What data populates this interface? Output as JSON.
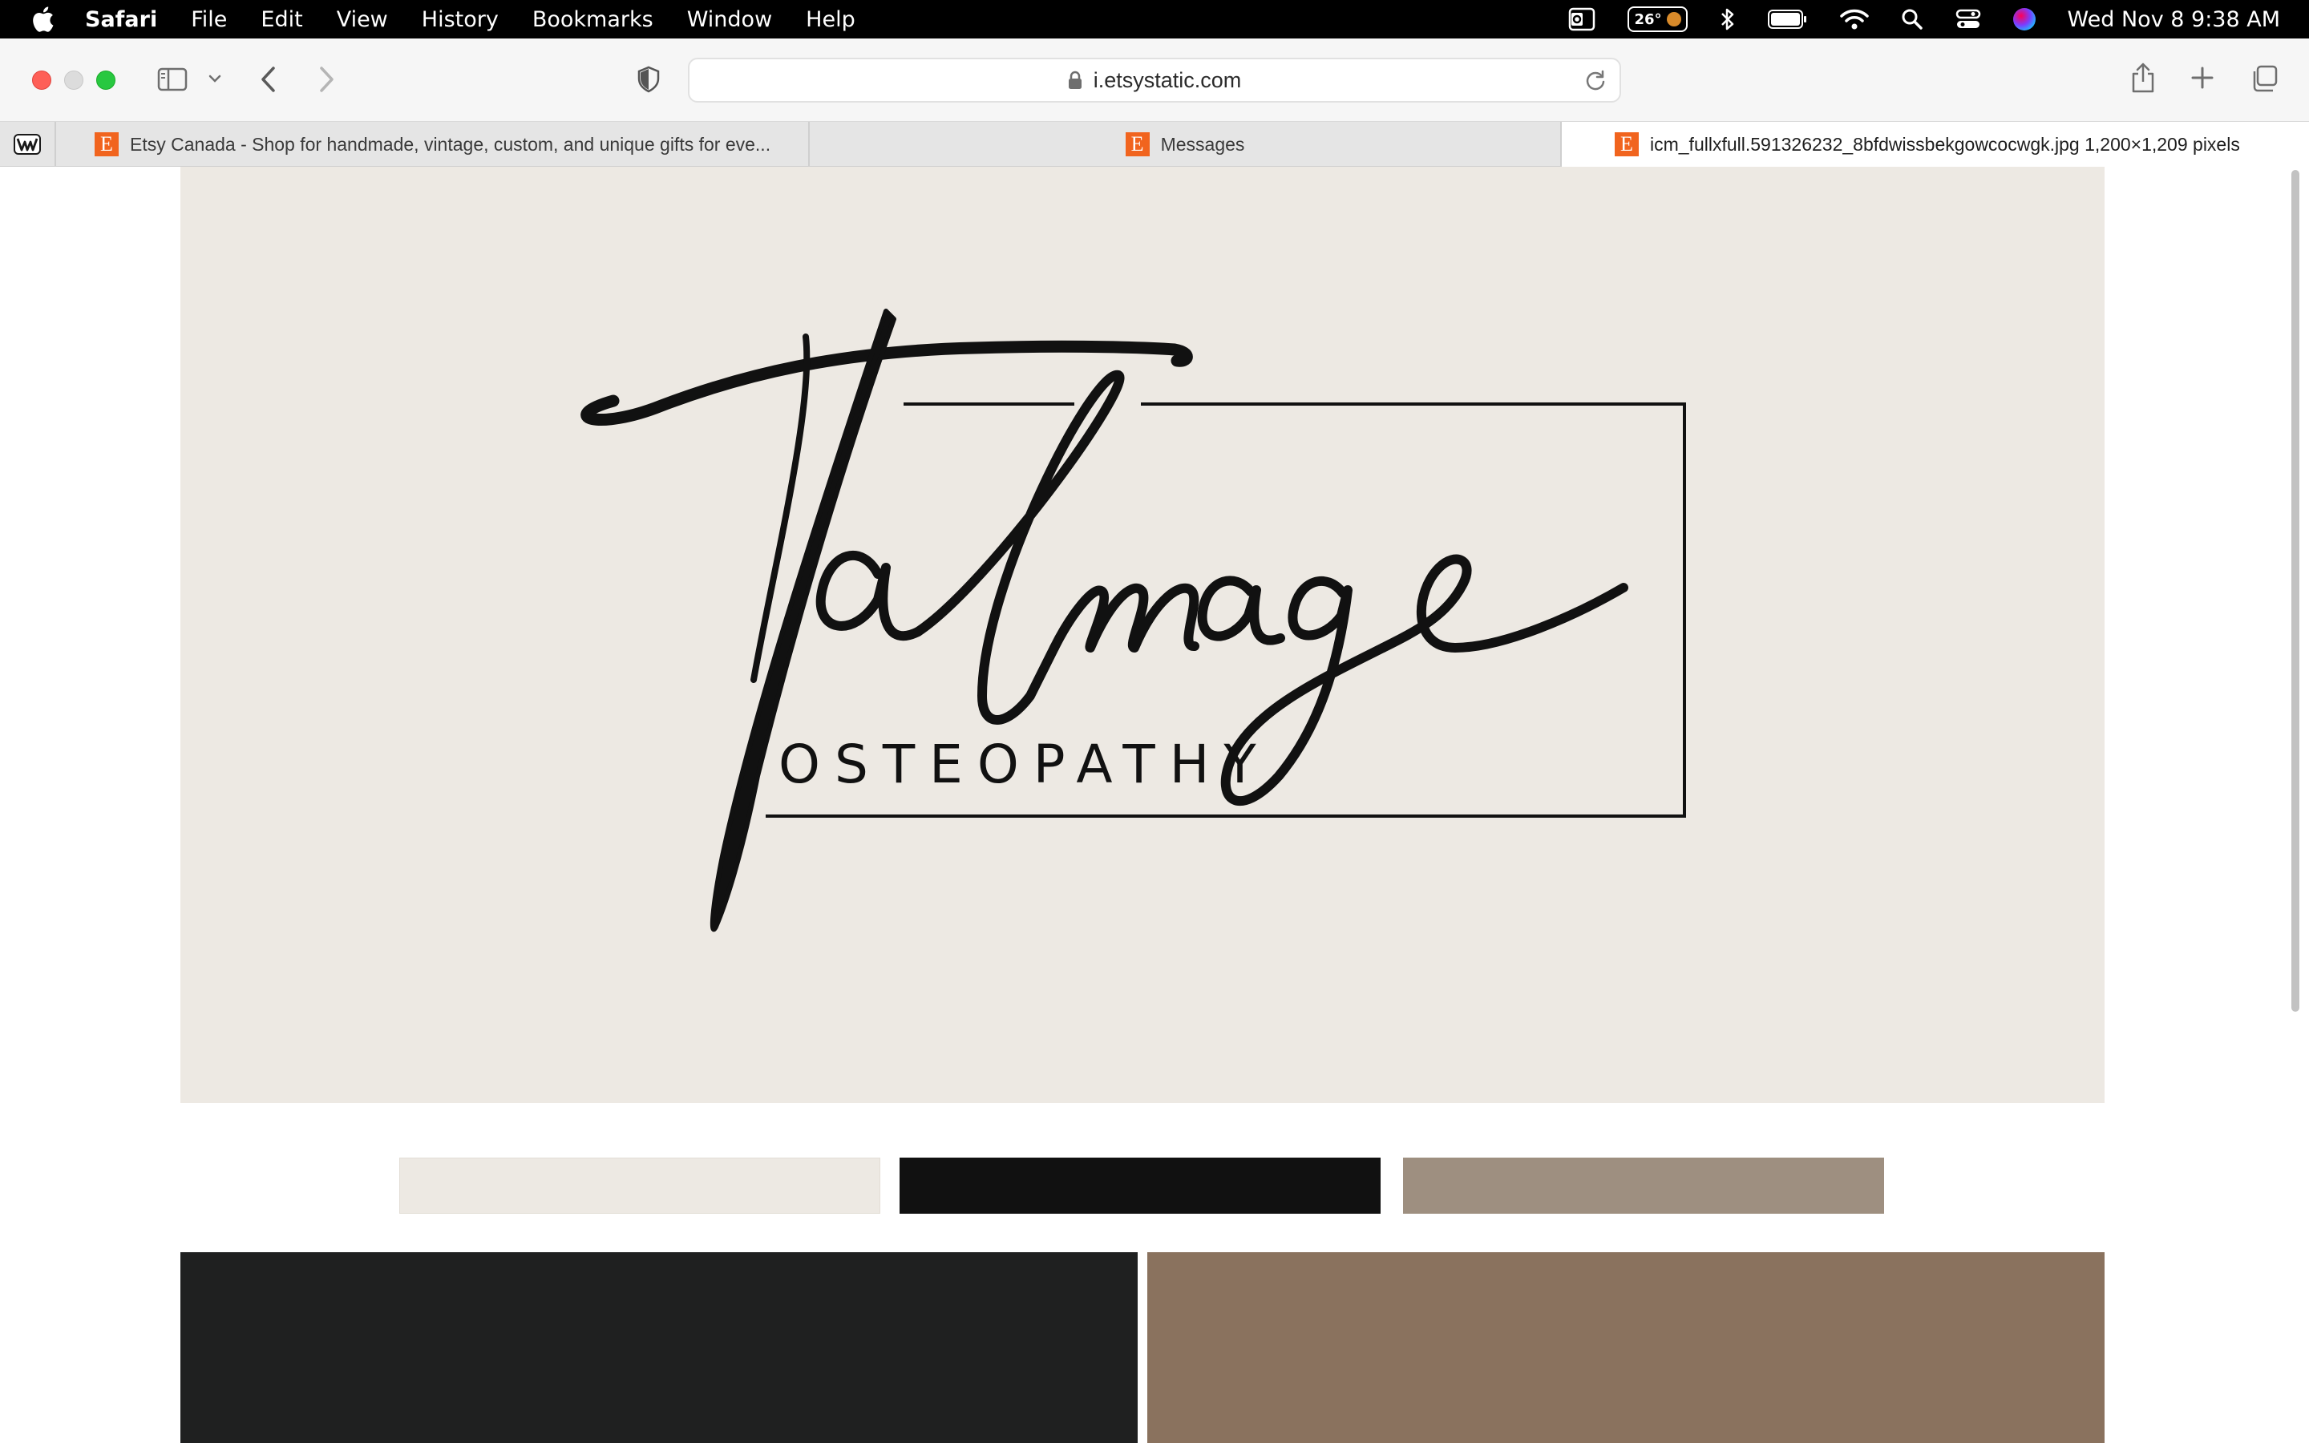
{
  "menubar": {
    "app_name": "Safari",
    "menus": [
      "File",
      "Edit",
      "View",
      "History",
      "Bookmarks",
      "Window",
      "Help"
    ],
    "weather_temp": "26°",
    "clock": "Wed Nov 8  9:38 AM"
  },
  "toolbar": {
    "url": "i.etsystatic.com"
  },
  "tabs": [
    {
      "title": "Etsy Canada - Shop for handmade, vintage, custom, and unique gifts for eve...",
      "favicon": "etsy-e-icon"
    },
    {
      "title": "Messages",
      "favicon": "etsy-e-icon"
    },
    {
      "title": "icm_fullxfull.591326232_8bfdwissbekgowcocwgk.jpg 1,200×1,209 pixels",
      "favicon": "etsy-e-icon"
    }
  ],
  "image": {
    "logo_script": "Talmage",
    "logo_subtitle": "OSTEOPATHY",
    "palette_colors": [
      "#ede9e3",
      "#111111",
      "#9e8f80"
    ],
    "bottom_colors": [
      "#1f2020",
      "#8a725e"
    ]
  },
  "colors": {
    "logo_background": "#ede9e3",
    "ink": "#111111"
  }
}
